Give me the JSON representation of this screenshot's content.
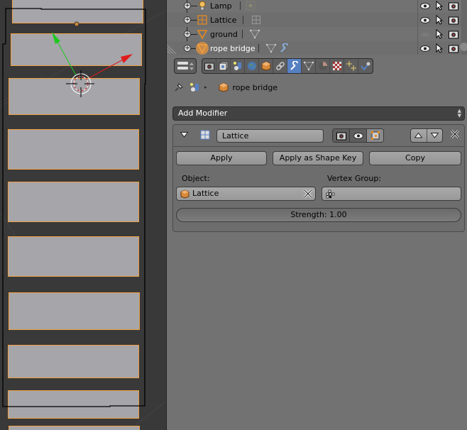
{
  "outliner": {
    "rows": [
      {
        "name": "Lamp",
        "type": "lamp",
        "visible": true
      },
      {
        "name": "Lattice",
        "type": "lattice",
        "visible": true
      },
      {
        "name": "ground",
        "type": "mesh",
        "visible": false
      },
      {
        "name": "rope bridge",
        "type": "mesh",
        "visible": true,
        "selected": true,
        "has_modifier": true
      }
    ]
  },
  "properties": {
    "context_tabs": [
      {
        "icon": "render-icon",
        "label": "Render"
      },
      {
        "icon": "render-layers-icon",
        "label": "Render Layers"
      },
      {
        "icon": "scene-icon",
        "label": "Scene"
      },
      {
        "icon": "world-icon",
        "label": "World"
      },
      {
        "icon": "object-icon",
        "label": "Object"
      },
      {
        "icon": "constraints-icon",
        "label": "Constraints"
      },
      {
        "icon": "modifiers-icon",
        "label": "Modifiers",
        "active": true
      },
      {
        "icon": "data-icon",
        "label": "Data"
      },
      {
        "icon": "material-icon",
        "label": "Material"
      },
      {
        "icon": "texture-icon",
        "label": "Texture"
      },
      {
        "icon": "particles-icon",
        "label": "Particles"
      },
      {
        "icon": "physics-icon",
        "label": "Physics"
      }
    ],
    "breadcrumb": {
      "object_name": "rope bridge"
    },
    "add_modifier_label": "Add Modifier",
    "modifier": {
      "name": "Lattice",
      "apply_label": "Apply",
      "apply_shape_key_label": "Apply as Shape Key",
      "copy_label": "Copy",
      "object_label": "Object:",
      "object_value": "Lattice",
      "vertex_group_label": "Vertex Group:",
      "vertex_group_value": "",
      "strength_label": "Strength: 1.00"
    }
  },
  "colors": {
    "accent_active_tab": "#5680c2",
    "selection_outline": "#f0a040",
    "viewport_bg": "#393939",
    "panel_bg": "#727272"
  }
}
